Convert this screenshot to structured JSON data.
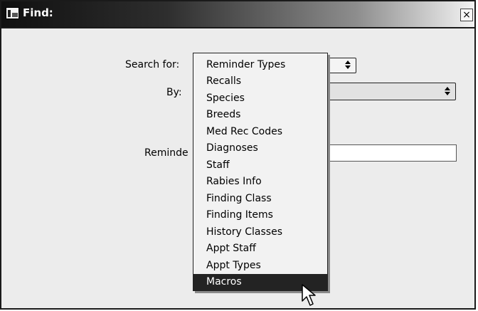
{
  "window": {
    "title": "Find:",
    "close_glyph": "×"
  },
  "form": {
    "search_for_label": "Search for:",
    "by_label": "By:",
    "reminder_label": "Reminde"
  },
  "dropdown": {
    "items": [
      "Reminder Types",
      "Recalls",
      "Species",
      "Breeds",
      "Med Rec Codes",
      "Diagnoses",
      "Staff",
      "Rabies Info",
      "Finding Class",
      "Finding Items",
      "History Classes",
      "Appt Staff",
      "Appt Types",
      "Macros"
    ],
    "highlighted": "Macros"
  },
  "colors": {
    "highlight": "#232323",
    "menu_bg": "#f2f2f2",
    "window_bg": "#ececec"
  },
  "icons": {
    "app": "app-icon",
    "close": "close-icon",
    "updown": "updown-arrows-icon",
    "cursor": "mouse-pointer-icon"
  }
}
